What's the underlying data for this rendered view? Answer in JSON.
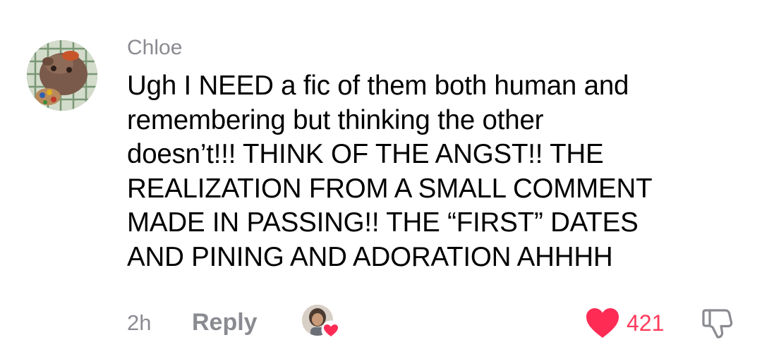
{
  "comment": {
    "author": "Chloe",
    "text_lines": [
      "Ugh I NEED a fic of them both human and",
      "remembering but thinking the other",
      "doesn’t!!! THINK OF THE ANGST!! THE",
      "REALIZATION FROM A SMALL COMMENT",
      "MADE IN PASSING!! THE “FIRST” DATES",
      "AND PINING AND ADORATION AHHHH"
    ],
    "timestamp": "2h",
    "reply_label": "Reply",
    "like_count": "421",
    "liked": true,
    "icons": {
      "avatar": "user-avatar",
      "creator_liked": "creator-liked-avatar",
      "like": "heart-icon",
      "dislike": "thumbs-down-icon"
    },
    "colors": {
      "accent": "#fe2c55",
      "muted_text": "#8a8b91",
      "body_text": "#000000"
    }
  }
}
